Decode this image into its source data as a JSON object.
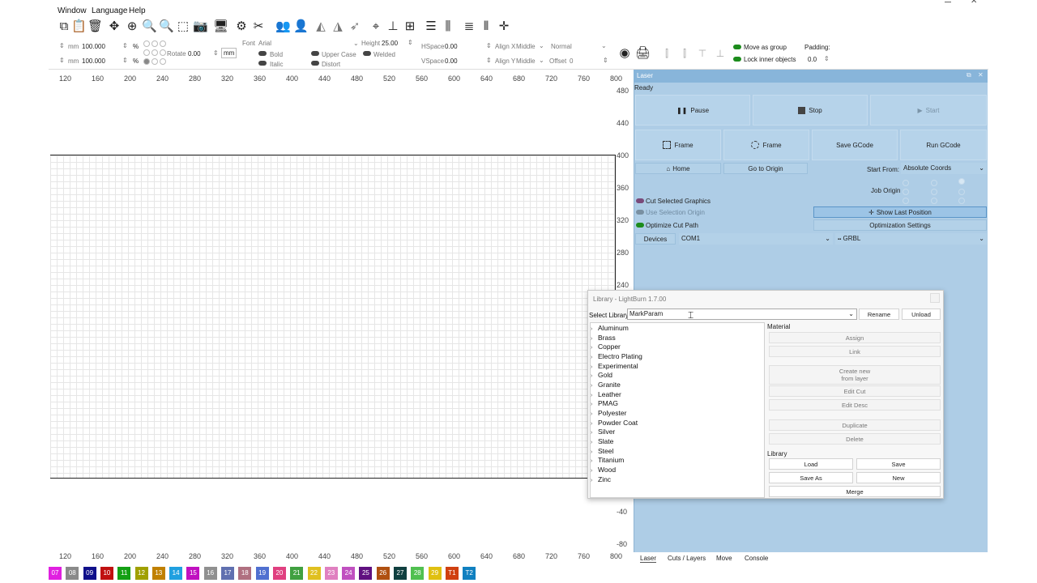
{
  "menu": [
    "Window",
    "Language",
    "Help"
  ],
  "toolbar2": {
    "unit1": "mm",
    "val1": "100.000",
    "pct1": "%",
    "unit2": "mm",
    "val2": "100.000",
    "pct2": "%",
    "rotate_label": "Rotate",
    "rotate_val": "0.00",
    "rotate_unit": "mm",
    "font_label": "Font",
    "font_val": "Arial",
    "height_label": "Height",
    "height_val": "25.00",
    "hspace_label": "HSpace",
    "hspace_val": "0.00",
    "vspace_label": "VSpace",
    "vspace_val": "0.00",
    "bold": "Bold",
    "italic": "Italic",
    "upper_case": "Upper Case",
    "welded": "Welded",
    "distort": "Distort",
    "alignx_label": "Align X",
    "alignx_val": "Middle",
    "aligny_label": "Align Y",
    "aligny_val": "Middle",
    "normal_val": "Normal",
    "offset_label": "Offset",
    "offset_val": "0",
    "move_as_group": "Move as group",
    "lock_inner": "Lock inner objects",
    "padding_label": "Padding:",
    "padding_val": "0.0"
  },
  "rulers": {
    "x": [
      "120",
      "160",
      "200",
      "240",
      "280",
      "320",
      "360",
      "400",
      "440",
      "480",
      "520",
      "560",
      "600",
      "640",
      "680",
      "720",
      "760",
      "800"
    ],
    "y": [
      "480",
      "440",
      "400",
      "360",
      "320",
      "280",
      "240",
      "-40",
      "-80"
    ]
  },
  "laser": {
    "title": "Laser",
    "status": "Ready",
    "pause": "Pause",
    "stop": "Stop",
    "start": "Start",
    "frame1": "Frame",
    "frame2": "Frame",
    "save_gcode": "Save GCode",
    "run_gcode": "Run GCode",
    "home": "Home",
    "go_to_origin": "Go to Origin",
    "start_from_label": "Start From:",
    "start_from_val": "Absolute Coords",
    "job_origin": "Job Origin",
    "cut_selected": "Cut Selected Graphics",
    "use_selection_origin": "Use Selection Origin",
    "optimize_cut_path": "Optimize Cut Path",
    "show_last_position": "Show Last Position",
    "optimization_settings": "Optimization Settings",
    "devices": "Devices",
    "port": "COM1",
    "controller": "GRBL"
  },
  "library": {
    "title": "Library - LightBurn 1.7.00",
    "select_label": "Select Library",
    "select_val": "MarkParam",
    "rename": "Rename",
    "unload": "Unload",
    "material_label": "Material",
    "items": [
      "Aluminum",
      "Brass",
      "Copper",
      "Electro Plating",
      "Experimental",
      "Gold",
      "Granite",
      "Leather",
      "PMAG",
      "Polyester",
      "Powder Coat",
      "Silver",
      "Slate",
      "Steel",
      "Titanium",
      "Wood",
      "Zinc"
    ],
    "assign": "Assign",
    "link": "Link",
    "create_new_1": "Create new",
    "create_new_2": "from layer",
    "edit_cut": "Edit Cut",
    "edit_desc": "Edit Desc",
    "duplicate": "Duplicate",
    "delete": "Delete",
    "library_label": "Library",
    "load": "Load",
    "save": "Save",
    "save_as": "Save As",
    "new": "New",
    "merge": "Merge"
  },
  "palette": [
    {
      "label": "07",
      "color": "#e020e0"
    },
    {
      "label": "08",
      "color": "#8a8a8a"
    },
    {
      "label": "09",
      "color": "#10108a"
    },
    {
      "label": "10",
      "color": "#c01010"
    },
    {
      "label": "11",
      "color": "#14a014"
    },
    {
      "label": "12",
      "color": "#a0a000"
    },
    {
      "label": "13",
      "color": "#c08000"
    },
    {
      "label": "14",
      "color": "#20a0e0"
    },
    {
      "label": "15",
      "color": "#c010c0"
    },
    {
      "label": "16",
      "color": "#909090"
    },
    {
      "label": "17",
      "color": "#6070b0"
    },
    {
      "label": "18",
      "color": "#b07080"
    },
    {
      "label": "19",
      "color": "#5070d0"
    },
    {
      "label": "20",
      "color": "#e04080"
    },
    {
      "label": "21",
      "color": "#40a040"
    },
    {
      "label": "22",
      "color": "#e0c020"
    },
    {
      "label": "23",
      "color": "#e080c0"
    },
    {
      "label": "24",
      "color": "#c050c0"
    },
    {
      "label": "25",
      "color": "#601080"
    },
    {
      "label": "26",
      "color": "#b05010"
    },
    {
      "label": "27",
      "color": "#104040"
    },
    {
      "label": "28",
      "color": "#50c050"
    },
    {
      "label": "29",
      "color": "#e0c010"
    },
    {
      "label": "T1",
      "color": "#d04010"
    },
    {
      "label": "T2",
      "color": "#1080c0"
    }
  ],
  "bottom_tabs": [
    "Laser",
    "Cuts / Layers",
    "Move",
    "Console"
  ]
}
